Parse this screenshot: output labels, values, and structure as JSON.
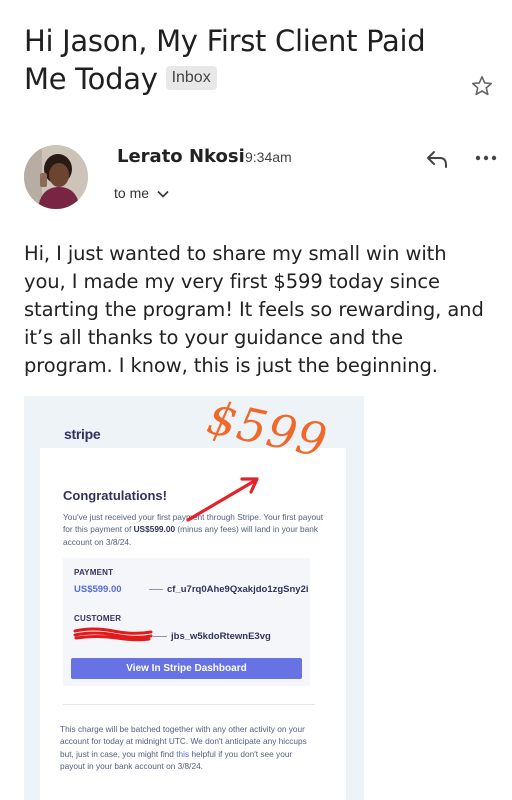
{
  "email": {
    "subject": "Hi Jason, My First Client Paid Me Today",
    "label": "Inbox",
    "sender": {
      "name": "Lerato Nkosi",
      "time": "9:34am",
      "recipient": "to me"
    },
    "body": "Hi, I just wanted to share my small win with you, I made my very first $599 today since starting the program! It feels so rewarding, and it’s all thanks to your guidance and the program. I know, this is just the beginning."
  },
  "receipt": {
    "brand": "stripe",
    "handwritten_amount": "$599",
    "heading": "Congratulations!",
    "intro_1": "You've just received your first payment through Stripe. Your first payout for this payment of ",
    "intro_amount": "US$599.00",
    "intro_2": " (minus any fees) will land in your bank account on 3/8/24.",
    "payment_label": "PAYMENT",
    "payment_amount": "US$599.00",
    "payment_id": "cf_u7rq0Ahe9Qxakjdo1zgSny2i",
    "customer_label": "CUSTOMER",
    "customer_id": "jbs_w5kdoRtewnE3vg",
    "dashboard_button": "View In Stripe Dashboard",
    "footer_1": "This charge will be batched together with any other activity on your account for today at midnight UTC. We don't anticipate any hiccups but, just in case, you might find ",
    "footer_link": "this",
    "footer_2": " helpful if you don't see your payout in your bank account on 3/8/24."
  },
  "colors": {
    "stripe_accent": "#6772e5",
    "handwriting": "#ef6a2a",
    "arrow": "#e5212a",
    "redaction": "#e01b1b"
  },
  "icons": {
    "star": "star-icon",
    "reply": "reply-icon",
    "more": "more-options-icon",
    "expand": "chevron-down-icon"
  }
}
